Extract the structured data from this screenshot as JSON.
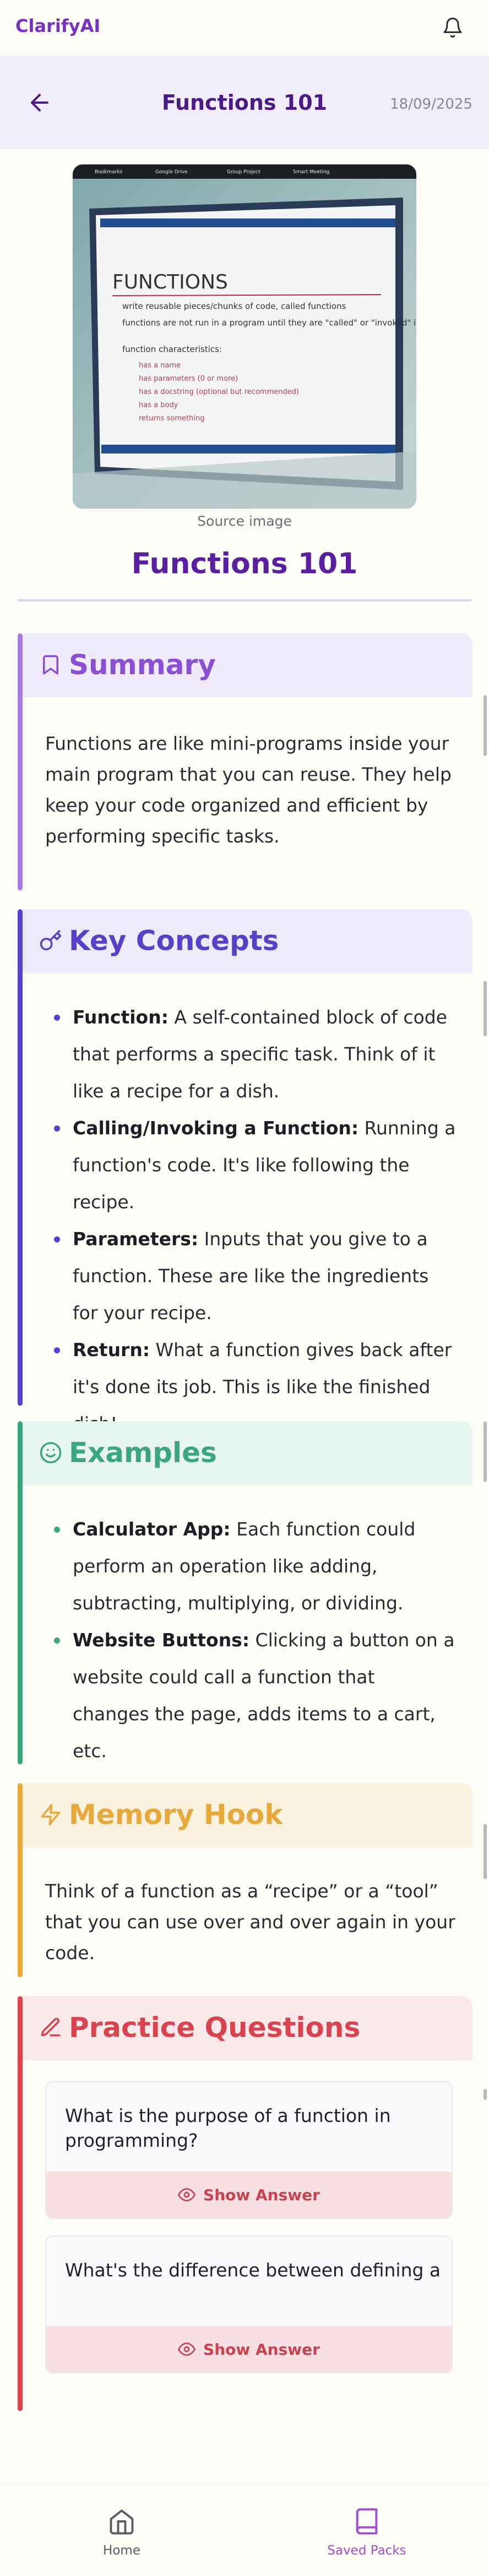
{
  "app": {
    "brand": "ClarifyAI"
  },
  "page_header": {
    "title": "Functions 101",
    "date": "18/09/2025"
  },
  "source_image": {
    "caption": "Source image",
    "slide_title": "FUNCTIONS",
    "slide_lines": [
      "write reusable pieces/chunks of code, called functions",
      "functions are not run in a program until they are \"called\" or \"invoked\" in a program",
      "function characteristics:",
      "has a name",
      "has parameters (0 or more)",
      "has a docstring (optional but recommended)",
      "has a body",
      "returns something"
    ],
    "tabs": [
      "Bookmarks",
      "Google Drive",
      "Group Project",
      "Smart Meeting"
    ]
  },
  "main_title": "Functions 101",
  "summary": {
    "heading": "Summary",
    "text": "Functions are like mini-programs inside your main program that you can reuse. They help keep your code organized and efficient by performing specific tasks."
  },
  "key_concepts": {
    "heading": "Key Concepts",
    "items": [
      {
        "term": "Function:",
        "desc": " A self-contained block of code that performs a specific task. Think of it like a recipe for a dish."
      },
      {
        "term": "Calling/Invoking a Function:",
        "desc": " Running a function's code. It's like following the recipe."
      },
      {
        "term": "Parameters:",
        "desc": " Inputs that you give to a function. These are like the ingredients for your recipe."
      },
      {
        "term": "Return:",
        "desc": " What a function gives back after it's done its job. This is like the finished dish!"
      }
    ]
  },
  "examples": {
    "heading": "Examples",
    "items": [
      {
        "term": "Calculator App:",
        "desc": " Each function could perform an operation like adding, subtracting, multiplying, or dividing."
      },
      {
        "term": "Website Buttons:",
        "desc": " Clicking a button on a website could call a function that changes the page, adds items to a cart, etc."
      }
    ]
  },
  "memory_hook": {
    "heading": "Memory Hook",
    "text": "Think of a function as a “recipe” or a “tool” that you can use over and over again in your code."
  },
  "practice": {
    "heading": "Practice Questions",
    "questions": [
      {
        "text": "What is the purpose of a function in programming?",
        "button": "Show Answer"
      },
      {
        "text": "What's the difference between defining a fu",
        "button": "Show Answer"
      }
    ]
  },
  "bottom_nav": {
    "home": "Home",
    "saved": "Saved Packs"
  },
  "colors": {
    "brand": "#7a2fc1",
    "summary": "#8b4fd6",
    "concepts": "#5a3fc9",
    "examples": "#3aa57f",
    "memory": "#e6a93a",
    "practice": "#d9434e"
  }
}
